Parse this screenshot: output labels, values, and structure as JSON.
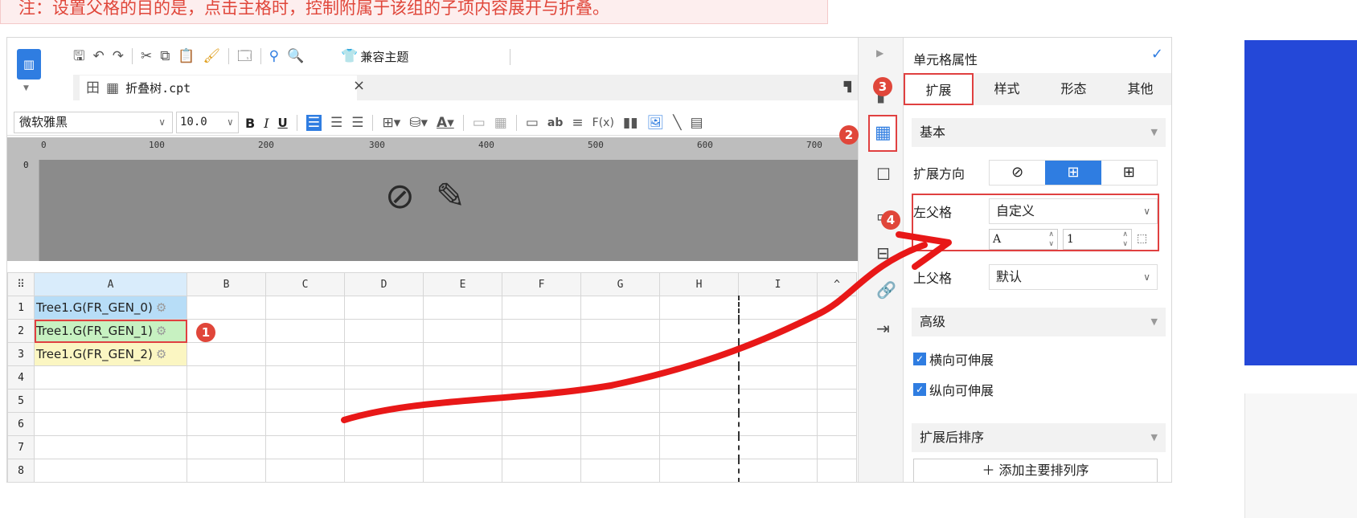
{
  "note": "注：设置父格的目的是，点击主格时，控制附属于该组的子项内容展开与折叠。",
  "toolbar": {
    "compat_theme": "兼容主题"
  },
  "tab": {
    "filename": "折叠树.cpt",
    "close": "×"
  },
  "format": {
    "font": "微软雅黑",
    "size": "10.0",
    "bold": "B",
    "italic": "I",
    "underline": "U"
  },
  "ruler": {
    "ticks": [
      "0",
      "100",
      "200",
      "300",
      "400",
      "500",
      "600",
      "700"
    ],
    "v0": "0"
  },
  "sheet": {
    "columns": [
      "A",
      "B",
      "C",
      "D",
      "E",
      "F",
      "G",
      "H",
      "I"
    ],
    "rows": [
      "1",
      "2",
      "3",
      "4",
      "5",
      "6",
      "7",
      "8"
    ],
    "cellA": [
      "Tree1.G(FR_GEN_0)",
      "Tree1.G(FR_GEN_1)",
      "Tree1.G(FR_GEN_2)"
    ]
  },
  "panel": {
    "title": "单元格属性",
    "tabs": [
      "扩展",
      "样式",
      "形态",
      "其他"
    ],
    "basic": "基本",
    "expand_dir": "扩展方向",
    "left_parent": "左父格",
    "left_parent_value": "自定义",
    "left_col": "A",
    "left_row": "1",
    "top_parent": "上父格",
    "top_parent_value": "默认",
    "advanced": "高级",
    "horiz_expand": "横向可伸展",
    "vert_expand": "纵向可伸展",
    "sort_after": "扩展后排序",
    "add_sort": "添加主要排列序"
  },
  "badges": [
    "1",
    "2",
    "3",
    "4"
  ]
}
